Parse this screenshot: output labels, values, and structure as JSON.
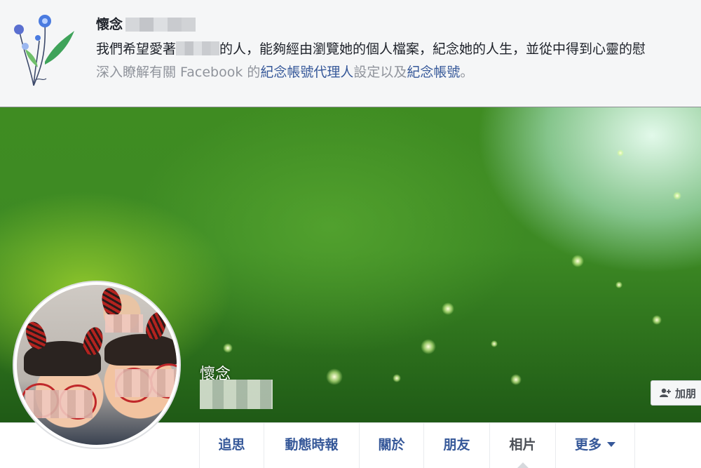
{
  "banner": {
    "title": "懷念",
    "message_before": "我們希望愛著",
    "message_after": "的人，能夠經由瀏覽她的個人檔案，紀念她的人生，並從中得到心靈的慰",
    "link_prefix": "深入瞭解有關 Facebook 的",
    "link_agent": "紀念帳號代理人",
    "link_middle": "設定以及",
    "link_account": "紀念帳號",
    "link_suffix": "。"
  },
  "profile": {
    "memorial_label": "懷念",
    "add_friend_label": "加朋"
  },
  "tabs": [
    {
      "label": "追思"
    },
    {
      "label": "動態時報"
    },
    {
      "label": "關於"
    },
    {
      "label": "朋友"
    },
    {
      "label": "相片"
    },
    {
      "label": "更多"
    }
  ],
  "colors": {
    "link": "#365899",
    "banner_bg": "#f5f6f7",
    "cover_green": "#3f8c22"
  }
}
